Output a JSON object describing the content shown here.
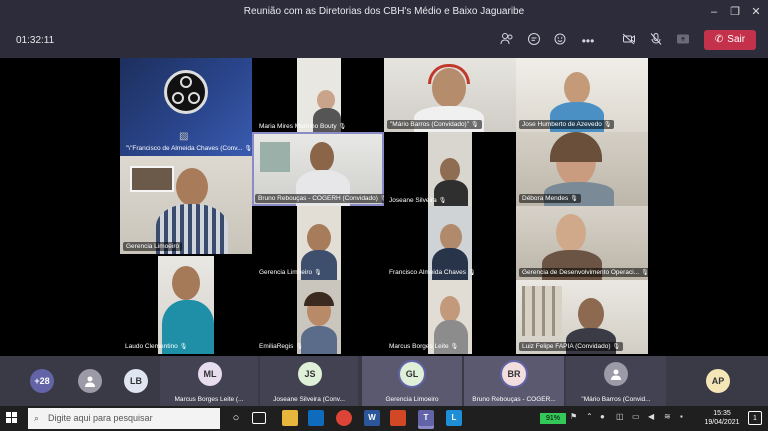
{
  "window": {
    "title": "Reunião com as Diretorias dos CBH's Médio e Baixo Jaguaribe"
  },
  "toolbar": {
    "timer": "01:32:11",
    "leave_label": "Sair"
  },
  "tiles": {
    "francisco_obs": "\"\\\"Francisco de  Almeida Chaves (Conv...",
    "maria": "Maria Mires Marinho Bouty",
    "mario": "\"Mário Barros (Convidado)\"",
    "jose": "Jose Humberto de Azevedo",
    "gerencia_top": "Gerencia Limoeiro",
    "bruno": "Bruno Rebouças - COGERH (Convidado)",
    "joseane": "Joseane Silveira",
    "debora": "Débora Mendes",
    "gerencia_mid": "Gerencia Limoeiro",
    "francisco": "Francisco Almeida  Chaves",
    "gerencia_dev": "Gerencia de Desenvolvimento Operaci...",
    "laudo": "Laudo Clementino",
    "emilia": "EmiliaRegis",
    "marcus": "Marcus Borges Leite",
    "luiz": "Luiz Felipe FAPIA (Convidado)"
  },
  "strip": {
    "overflow_count": "+28",
    "chips": [
      {
        "initials": "",
        "name": ""
      },
      {
        "initials": "LB",
        "name": ""
      },
      {
        "initials": "ML",
        "name": "Marcus Borges Leite (..."
      },
      {
        "initials": "JS",
        "name": "Joseane Silveira (Conv..."
      },
      {
        "initials": "GL",
        "name": "Gerencia Limoeiro"
      },
      {
        "initials": "BR",
        "name": "Bruno Rebouças - COGER..."
      },
      {
        "initials": "",
        "name": "\"Mário Barros (Convid..."
      },
      {
        "initials": "AP",
        "name": ""
      }
    ]
  },
  "taskbar": {
    "search_placeholder": "Digite aqui para pesquisar",
    "battery": "91%",
    "time": "15:35",
    "date": "19/04/2021",
    "notifications": "1"
  },
  "colors": {
    "titlebar": "#2d2c3a",
    "leave": "#c4314b",
    "accent": "#6264a7",
    "strip": "#3a3946"
  }
}
